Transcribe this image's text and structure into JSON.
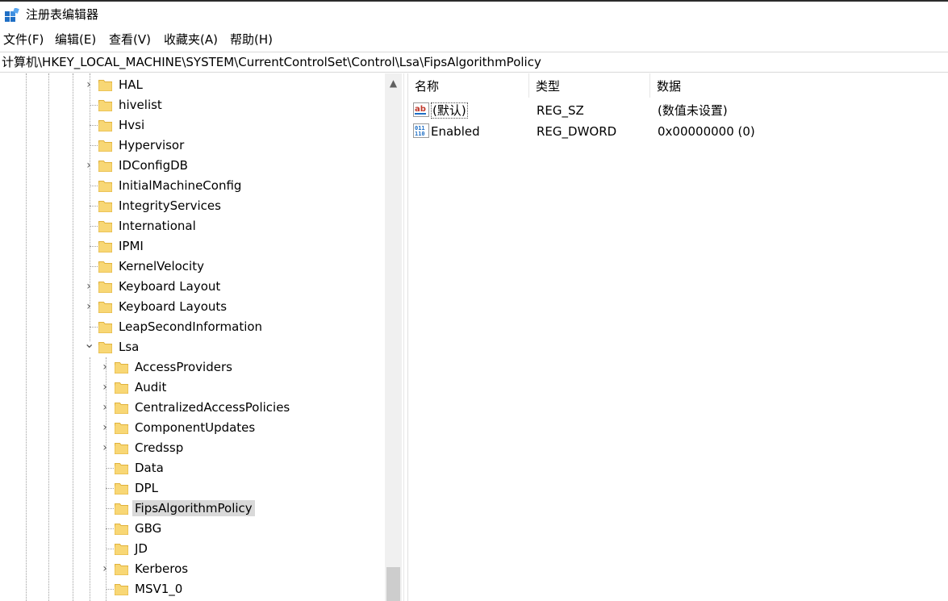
{
  "window": {
    "title": "注册表编辑器"
  },
  "menu": [
    "文件(F)",
    "编辑(E)",
    "查看(V)",
    "收藏夹(A)",
    "帮助(H)"
  ],
  "address": "计算机\\HKEY_LOCAL_MACHINE\\SYSTEM\\CurrentControlSet\\Control\\Lsa\\FipsAlgorithmPolicy",
  "tree": [
    {
      "label": "HAL",
      "expandable": true,
      "depth": 1
    },
    {
      "label": "hivelist",
      "expandable": false,
      "depth": 1
    },
    {
      "label": "Hvsi",
      "expandable": false,
      "depth": 1
    },
    {
      "label": "Hypervisor",
      "expandable": false,
      "depth": 1
    },
    {
      "label": "IDConfigDB",
      "expandable": true,
      "depth": 1
    },
    {
      "label": "InitialMachineConfig",
      "expandable": false,
      "depth": 1
    },
    {
      "label": "IntegrityServices",
      "expandable": false,
      "depth": 1
    },
    {
      "label": "International",
      "expandable": false,
      "depth": 1
    },
    {
      "label": "IPMI",
      "expandable": false,
      "depth": 1
    },
    {
      "label": "KernelVelocity",
      "expandable": false,
      "depth": 1
    },
    {
      "label": "Keyboard Layout",
      "expandable": true,
      "depth": 1
    },
    {
      "label": "Keyboard Layouts",
      "expandable": true,
      "depth": 1
    },
    {
      "label": "LeapSecondInformation",
      "expandable": false,
      "depth": 1
    },
    {
      "label": "Lsa",
      "expandable": true,
      "expanded": true,
      "depth": 1
    },
    {
      "label": "AccessProviders",
      "expandable": true,
      "depth": 2
    },
    {
      "label": "Audit",
      "expandable": true,
      "depth": 2
    },
    {
      "label": "CentralizedAccessPolicies",
      "expandable": true,
      "depth": 2
    },
    {
      "label": "ComponentUpdates",
      "expandable": true,
      "depth": 2
    },
    {
      "label": "Credssp",
      "expandable": true,
      "depth": 2
    },
    {
      "label": "Data",
      "expandable": false,
      "depth": 2
    },
    {
      "label": "DPL",
      "expandable": false,
      "depth": 2
    },
    {
      "label": "FipsAlgorithmPolicy",
      "expandable": false,
      "depth": 2,
      "selected": true
    },
    {
      "label": "GBG",
      "expandable": false,
      "depth": 2
    },
    {
      "label": "JD",
      "expandable": false,
      "depth": 2
    },
    {
      "label": "Kerberos",
      "expandable": true,
      "depth": 2
    },
    {
      "label": "MSV1_0",
      "expandable": false,
      "depth": 2
    }
  ],
  "columns": {
    "name": "名称",
    "type": "类型",
    "data": "数据"
  },
  "values": [
    {
      "icon": "string-value-icon",
      "name": "(默认)",
      "type": "REG_SZ",
      "data": "(数值未设置)"
    },
    {
      "icon": "dword-value-icon",
      "name": "Enabled",
      "type": "REG_DWORD",
      "data": "0x00000000 (0)"
    }
  ],
  "colors": {
    "folder": "#f8d775",
    "folder_dark": "#e0b23c",
    "selection": "#d9d9d9",
    "icon_blue": "#1f6fc5",
    "icon_red": "#c0392b"
  }
}
